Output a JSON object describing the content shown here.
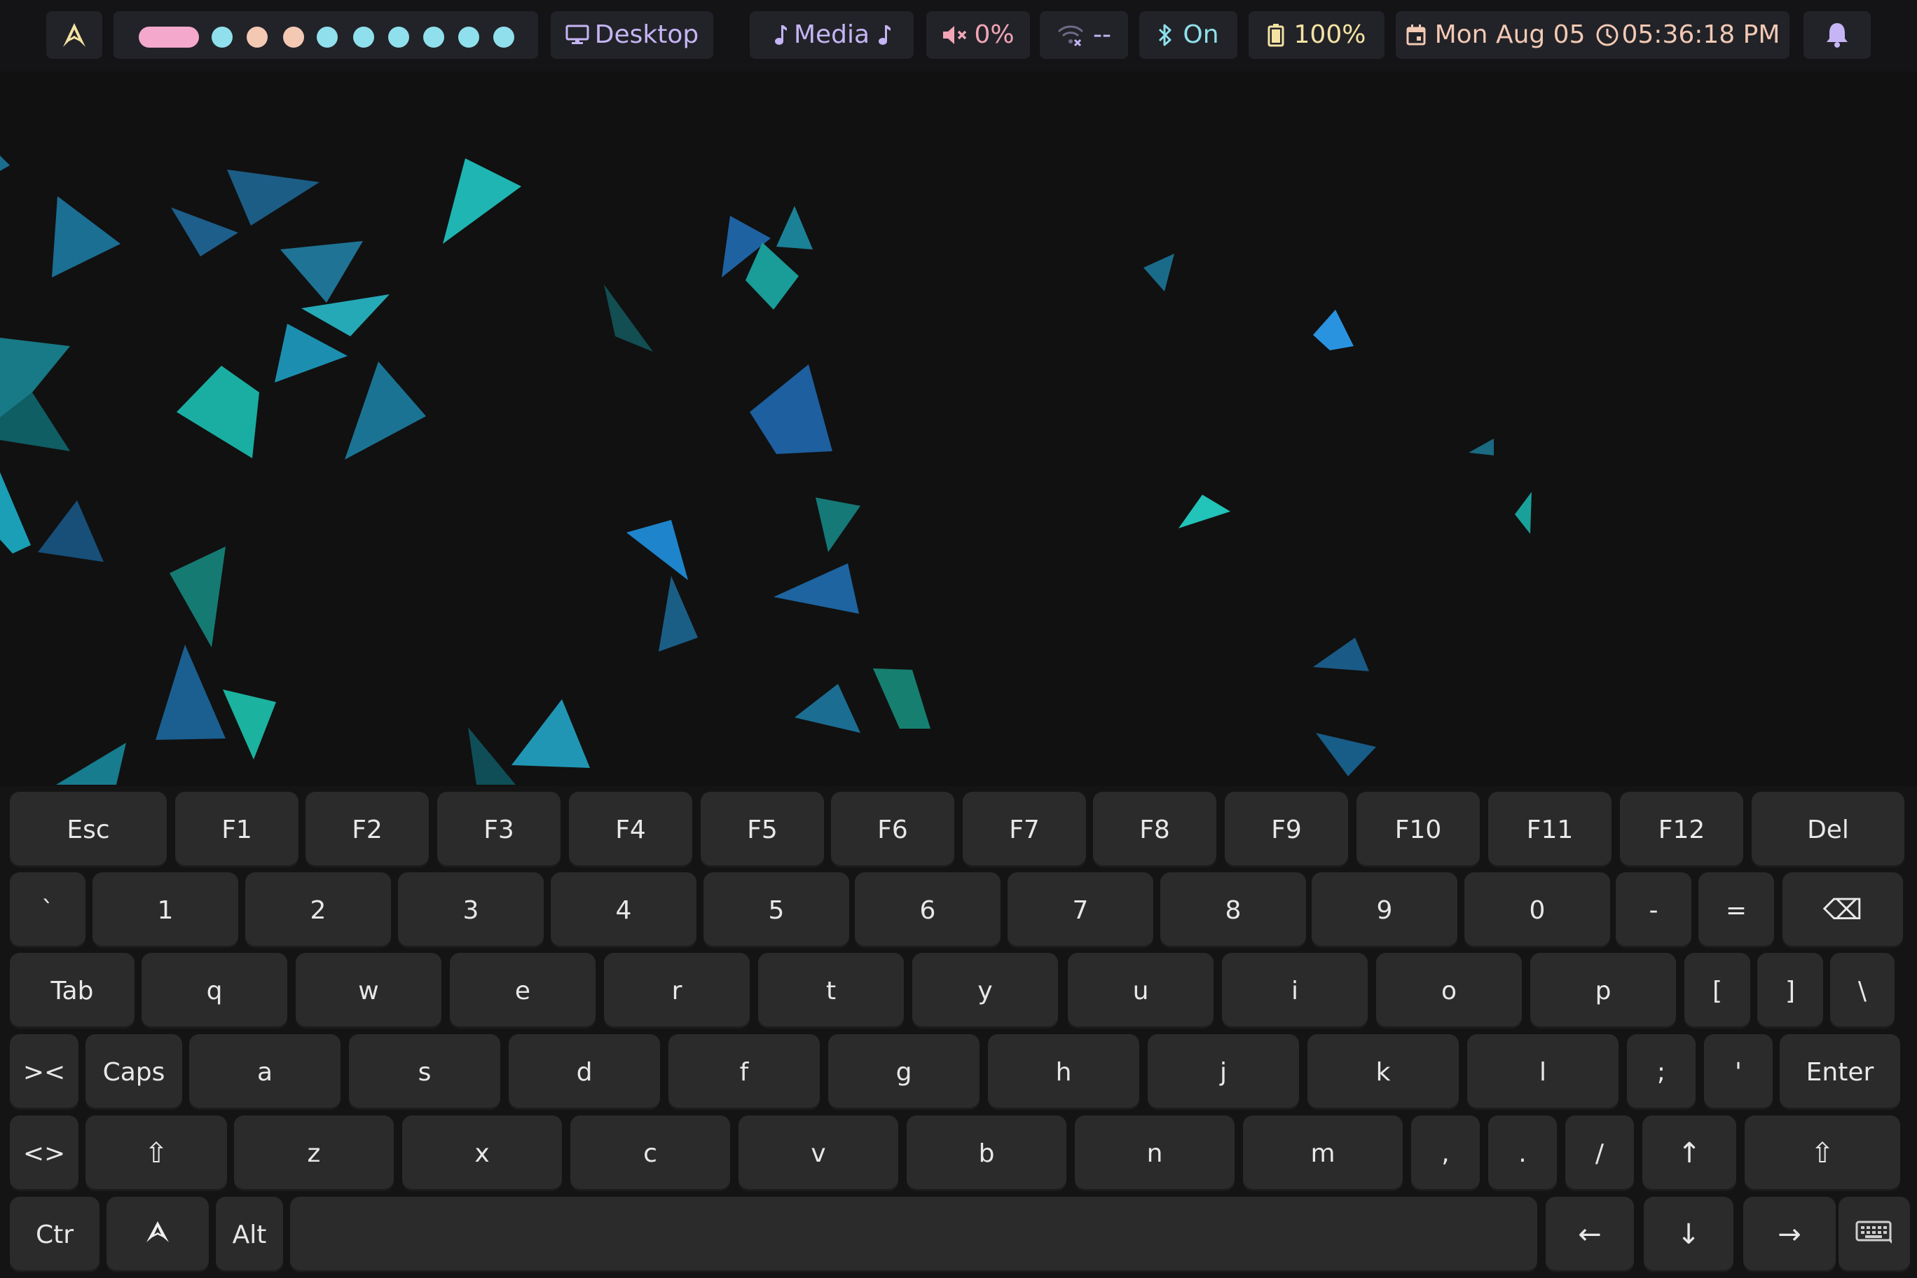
{
  "colors": {
    "bar_bg": "#141416",
    "module_bg": "#222328",
    "lavender": "#c5b5f5",
    "pink": "#f2a5b6",
    "peach": "#f3c9b4",
    "cyan": "#8fe0ec",
    "yellow": "#f5e3a3",
    "wallpaper_bg": "#111111",
    "key_bg": "#2b2b2b",
    "key_text": "#e8e8e8"
  },
  "topbar": {
    "launcher_icon": "arch-logo-icon",
    "workspaces": [
      {
        "state": "active",
        "color": "#f4a9cc"
      },
      {
        "state": "occupied",
        "color": "#8fe0ec"
      },
      {
        "state": "occupied",
        "color": "#f3c9b4"
      },
      {
        "state": "occupied",
        "color": "#f3c9b4"
      },
      {
        "state": "empty",
        "color": "#8fe0ec"
      },
      {
        "state": "empty",
        "color": "#8fe0ec"
      },
      {
        "state": "empty",
        "color": "#8fe0ec"
      },
      {
        "state": "empty",
        "color": "#8fe0ec"
      },
      {
        "state": "empty",
        "color": "#8fe0ec"
      },
      {
        "state": "empty",
        "color": "#8fe0ec"
      }
    ],
    "window_title": "Desktop",
    "window_icon": "monitor-icon",
    "media": "Media",
    "media_icon": "music-note-icon",
    "volume": "0%",
    "volume_icon": "speaker-muted-icon",
    "network": "--",
    "network_icon": "wifi-disconnected-icon",
    "bluetooth": "On",
    "bluetooth_icon": "bluetooth-icon",
    "battery": "100%",
    "battery_icon": "battery-icon",
    "date": "Mon Aug 05",
    "date_icon": "calendar-icon",
    "time": "05:36:18 PM",
    "time_icon": "clock-icon",
    "notifications_icon": "bell-icon"
  },
  "keyboard": {
    "rows": [
      [
        "Esc",
        "F1",
        "F2",
        "F3",
        "F4",
        "F5",
        "F6",
        "F7",
        "F8",
        "F9",
        "F10",
        "F11",
        "F12",
        "Del"
      ],
      [
        "`",
        "1",
        "2",
        "3",
        "4",
        "5",
        "6",
        "7",
        "8",
        "9",
        "0",
        "-",
        "=",
        "⌫"
      ],
      [
        "Tab",
        "q",
        "w",
        "e",
        "r",
        "t",
        "y",
        "u",
        "i",
        "o",
        "p",
        "[",
        "]",
        "\\"
      ],
      [
        "><",
        "Caps",
        "a",
        "s",
        "d",
        "f",
        "g",
        "h",
        "j",
        "k",
        "l",
        ";",
        "'",
        "Enter"
      ],
      [
        "<>",
        "⇧",
        "z",
        "x",
        "c",
        "v",
        "b",
        "n",
        "m",
        ",",
        ".",
        "/",
        "↑",
        "⇧"
      ],
      [
        "Ctr",
        "",
        "Alt",
        "",
        "←",
        "↓",
        "→",
        ""
      ]
    ],
    "super_key_icon": "arch-logo-icon",
    "hide_keyboard_icon": "keyboard-icon"
  }
}
